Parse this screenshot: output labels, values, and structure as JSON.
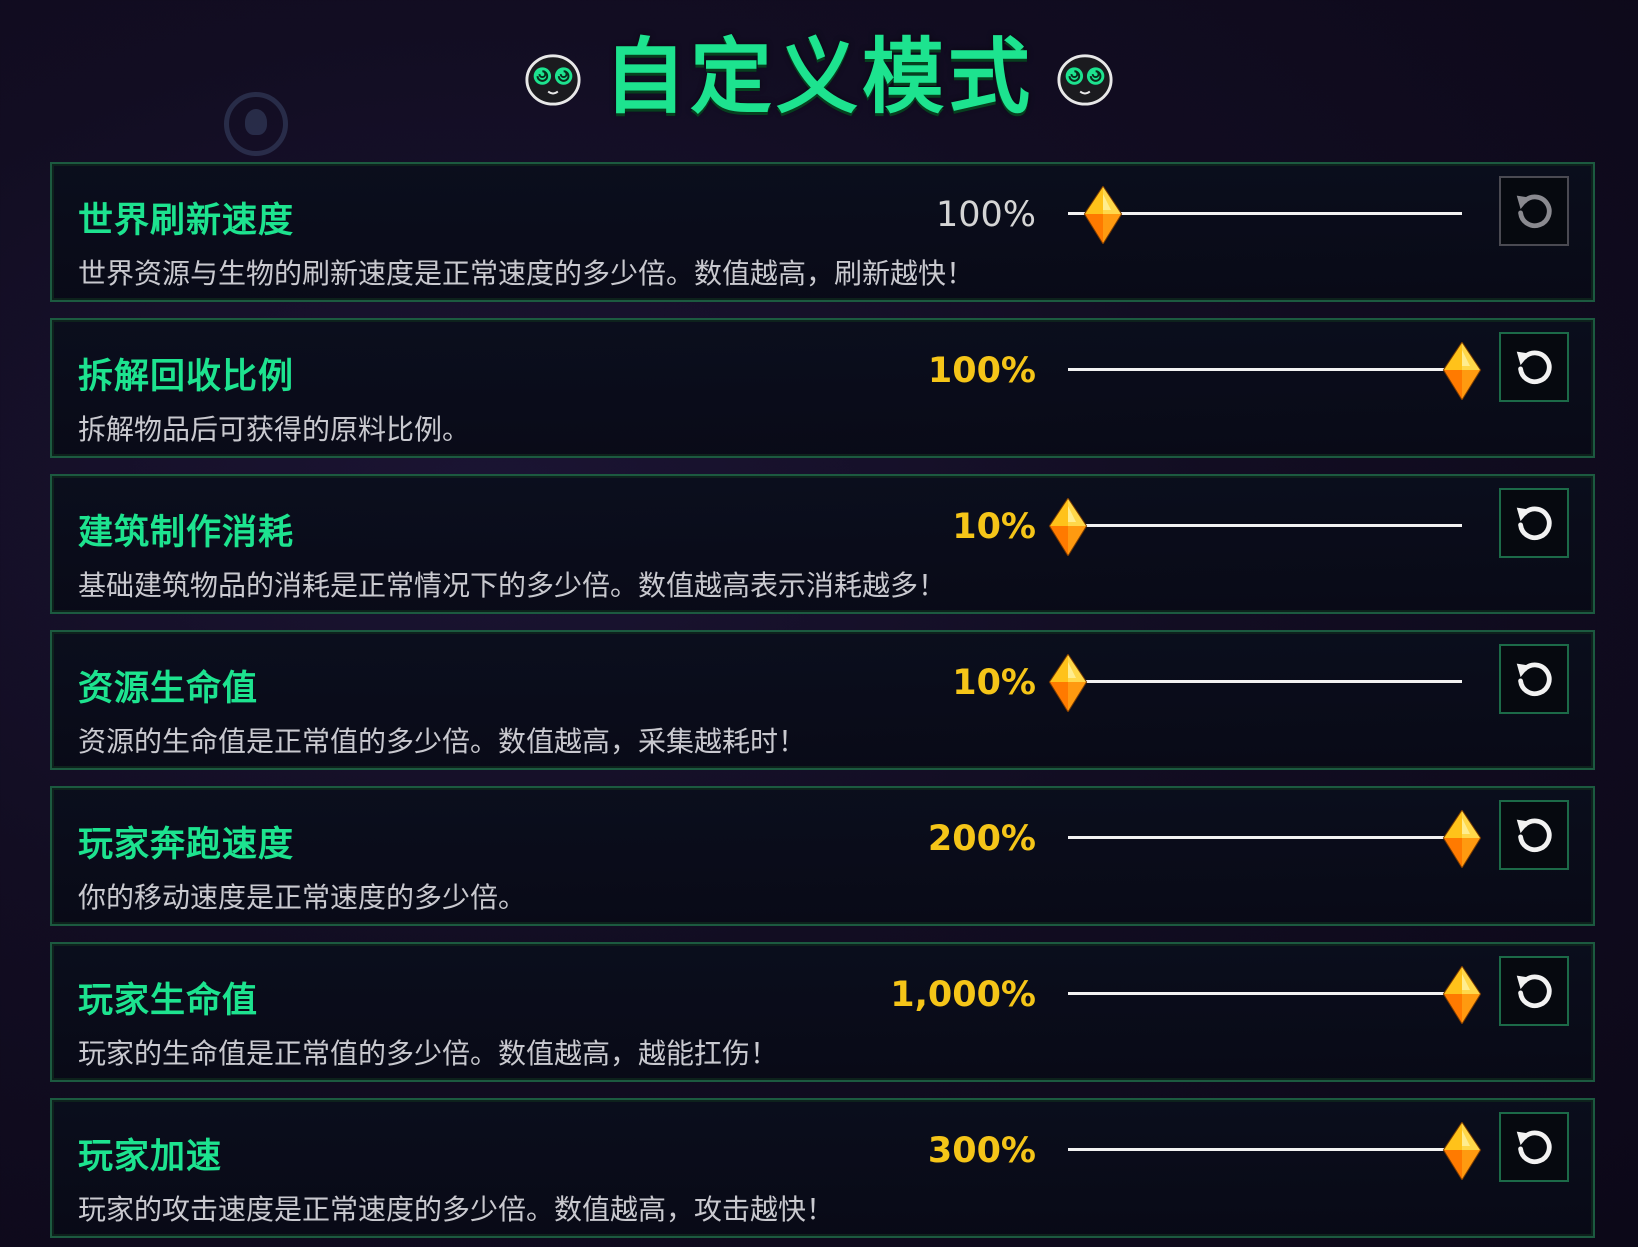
{
  "header": {
    "title": "自定义模式"
  },
  "colors": {
    "accent_green": "#1de38f",
    "value_gold": "#f5c518",
    "value_muted": "#d5d5d5",
    "panel_border": "#1c5a40",
    "background": "#120d22"
  },
  "settings": [
    {
      "title": "世界刷新速度",
      "value": "100%",
      "slider_position": 0.09,
      "description": "世界资源与生物的刷新速度是正常速度的多少倍。数值越高，刷新越快！",
      "is_default": true
    },
    {
      "title": "拆解回收比例",
      "value": "100%",
      "slider_position": 1.0,
      "description": "拆解物品后可获得的原料比例。",
      "is_default": false
    },
    {
      "title": "建筑制作消耗",
      "value": "10%",
      "slider_position": 0.0,
      "description": "基础建筑物品的消耗是正常情况下的多少倍。数值越高表示消耗越多！",
      "is_default": false
    },
    {
      "title": "资源生命值",
      "value": "10%",
      "slider_position": 0.0,
      "description": "资源的生命值是正常值的多少倍。数值越高，采集越耗时！",
      "is_default": false
    },
    {
      "title": "玩家奔跑速度",
      "value": "200%",
      "slider_position": 1.0,
      "description": "你的移动速度是正常速度的多少倍。",
      "is_default": false
    },
    {
      "title": "玩家生命值",
      "value": "1,000%",
      "slider_position": 1.0,
      "description": "玩家的生命值是正常值的多少倍。数值越高，越能扛伤！",
      "is_default": false
    },
    {
      "title": "玩家加速",
      "value": "300%",
      "slider_position": 1.0,
      "description": "玩家的攻击速度是正常速度的多少倍。数值越高，攻击越快！",
      "is_default": false
    }
  ]
}
